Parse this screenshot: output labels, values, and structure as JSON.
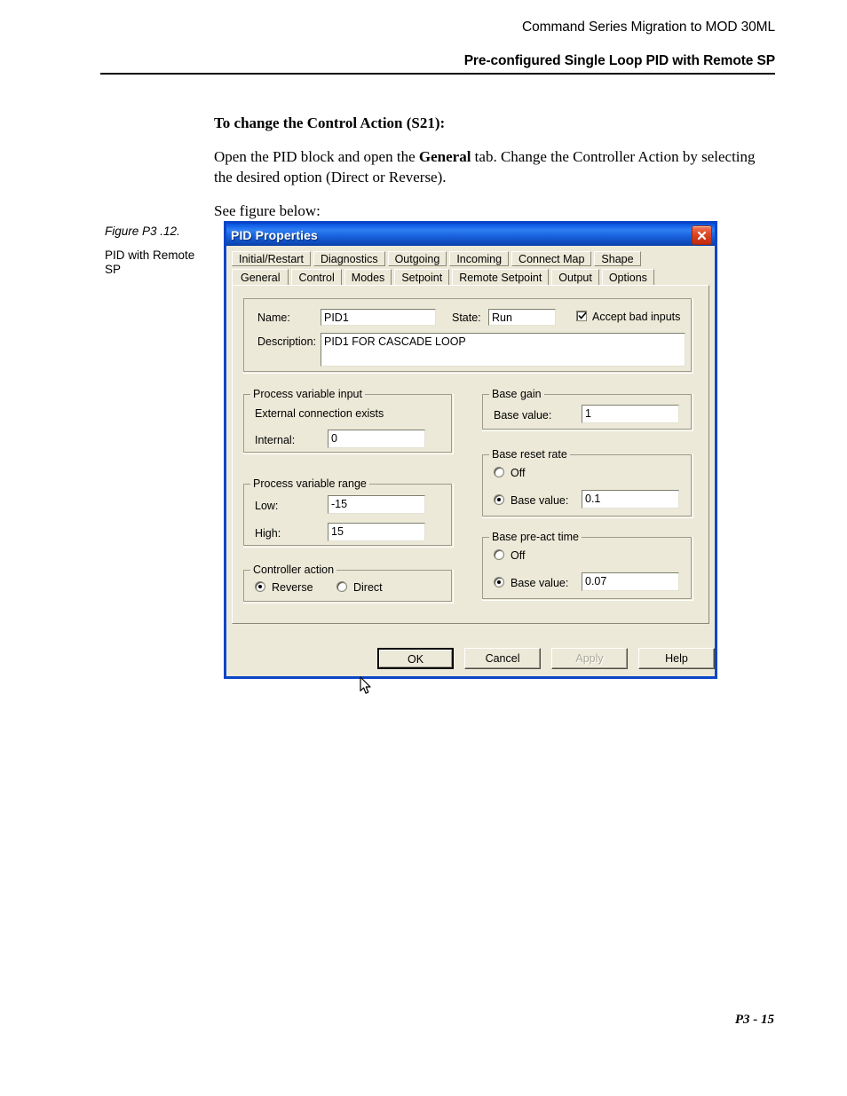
{
  "page": {
    "header_line1": "Command Series Migration to MOD 30ML",
    "header_line2": "Pre-configured Single Loop PID with Remote SP",
    "footer_page": "P3 - 15"
  },
  "body": {
    "heading": "To change the Control Action (S21):",
    "para1_part1": "Open the PID block and open the ",
    "para1_bold": "General",
    "para1_part2": " tab. Change the Controller Action by selecting the desired option (Direct or Reverse).",
    "para2": "See figure below:"
  },
  "figure": {
    "number": "Figure P3 .12.",
    "caption": "PID with Remote SP"
  },
  "dialog": {
    "title": "PID Properties",
    "close_icon": "close-x-icon",
    "tabs_row1": [
      {
        "label": "Initial/Restart",
        "active": false
      },
      {
        "label": "Diagnostics",
        "active": false
      },
      {
        "label": "Outgoing",
        "active": false
      },
      {
        "label": "Incoming",
        "active": false
      },
      {
        "label": "Connect Map",
        "active": false
      },
      {
        "label": "Shape",
        "active": false
      }
    ],
    "tabs_row2": [
      {
        "label": "General",
        "active": true
      },
      {
        "label": "Control",
        "active": false
      },
      {
        "label": "Modes",
        "active": false
      },
      {
        "label": "Setpoint",
        "active": false
      },
      {
        "label": "Remote Setpoint",
        "active": false
      },
      {
        "label": "Output",
        "active": false
      },
      {
        "label": "Options",
        "active": false
      }
    ],
    "identity": {
      "name_label": "Name:",
      "name_value": "PID1",
      "state_label": "State:",
      "state_value": "Run",
      "state_options": [
        "Run"
      ],
      "accept_bad_inputs_label": "Accept bad inputs",
      "accept_bad_inputs_checked": true,
      "description_label": "Description:",
      "description_value": "PID1 FOR CASCADE LOOP"
    },
    "pv_input": {
      "group_label": "Process variable input",
      "external_text": "External connection exists",
      "internal_label": "Internal:",
      "internal_value": "0"
    },
    "pv_range": {
      "group_label": "Process variable range",
      "low_label": "Low:",
      "low_value": "-15",
      "high_label": "High:",
      "high_value": "15"
    },
    "controller_action": {
      "group_label": "Controller action",
      "reverse_label": "Reverse",
      "reverse_selected": true,
      "direct_label": "Direct",
      "direct_selected": false
    },
    "base_gain": {
      "group_label": "Base gain",
      "value_label": "Base value:",
      "value": "1"
    },
    "base_reset_rate": {
      "group_label": "Base reset rate",
      "off_label": "Off",
      "off_selected": false,
      "value_label": "Base value:",
      "value_selected": true,
      "value": "0.1"
    },
    "base_pre_act_time": {
      "group_label": "Base pre-act time",
      "off_label": "Off",
      "off_selected": false,
      "value_label": "Base value:",
      "value_selected": true,
      "value": "0.07"
    },
    "buttons": {
      "ok": "OK",
      "cancel": "Cancel",
      "apply": "Apply",
      "apply_enabled": false,
      "help": "Help"
    }
  },
  "colors": {
    "title_bar_blue": "#1160e8",
    "dialog_face": "#ece9d8",
    "close_red": "#dd4525",
    "frame_blue": "#0a46c8"
  }
}
